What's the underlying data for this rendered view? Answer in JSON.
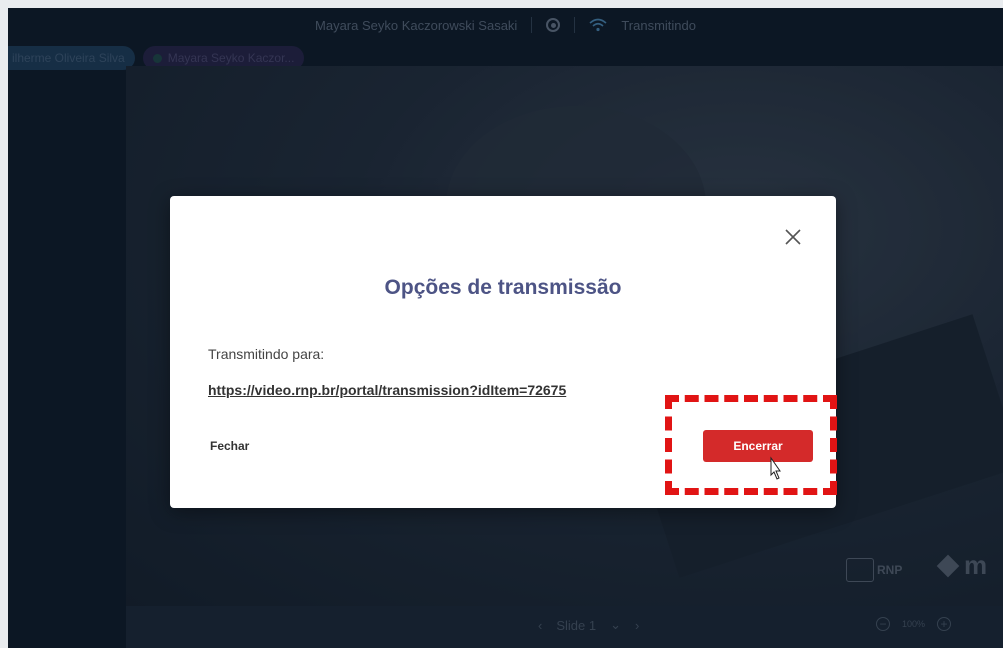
{
  "topbar": {
    "presenter": "Mayara Seyko Kaczorowski Sasaki",
    "status": "Transmitindo"
  },
  "participants": [
    "ilherme Oliveira Silva",
    "Mayara Seyko Kaczor..."
  ],
  "stage": {
    "brand_rnp": "RNP",
    "brand_m": "m"
  },
  "bottombar": {
    "slide_label": "Slide 1",
    "zoom": "100%"
  },
  "modal": {
    "title": "Opções de transmissão",
    "label": "Transmitindo para:",
    "link": "https://video.rnp.br/portal/transmission?idItem=72675",
    "close_label": "Fechar",
    "end_label": "Encerrar"
  },
  "colors": {
    "title": "#4d5485",
    "end_button": "#d42a2a",
    "highlight": "#e11414"
  },
  "icons": [
    "record-icon",
    "wifi-icon",
    "close-icon",
    "chevron-left-icon",
    "chevron-down-icon",
    "chevron-right-icon",
    "zoom-out-icon",
    "zoom-in-icon",
    "cursor-icon"
  ]
}
